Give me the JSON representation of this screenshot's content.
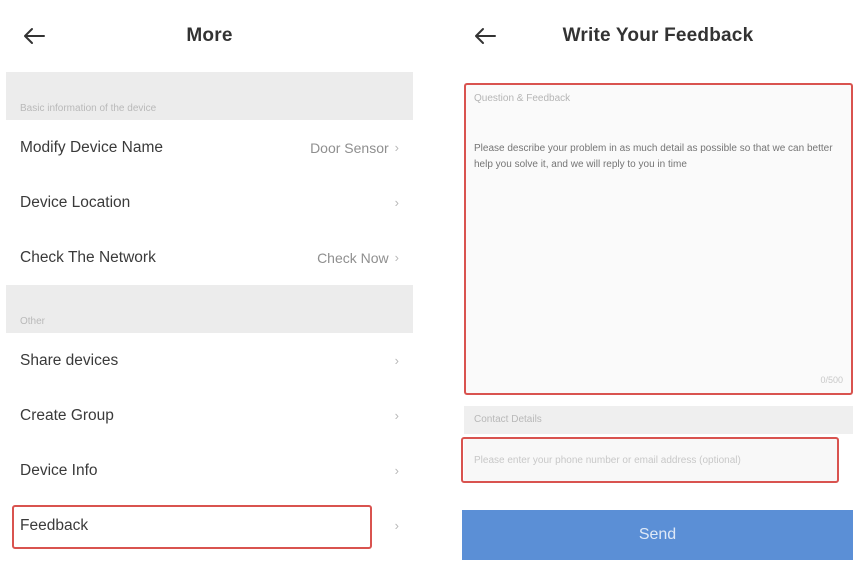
{
  "left": {
    "title": "More",
    "section1": {
      "header": "Basic information of the device"
    },
    "section1_rows": [
      {
        "label": "Modify Device Name",
        "value": "Door Sensor"
      },
      {
        "label": "Device Location",
        "value": ""
      },
      {
        "label": "Check The Network",
        "value": "Check Now"
      }
    ],
    "section2": {
      "header": "Other"
    },
    "section2_rows": [
      {
        "label": "Share devices"
      },
      {
        "label": "Create Group"
      },
      {
        "label": "Device Info"
      },
      {
        "label": "Feedback"
      }
    ]
  },
  "right": {
    "title": "Write Your Feedback",
    "feedback_label": "Question & Feedback",
    "feedback_placeholder": "Please describe your problem in as much detail as possible so that we can better help you solve it, and we will reply to you in time",
    "char_count": "0/500",
    "contact_label": "Contact Details",
    "contact_placeholder": "Please enter your phone number or email address (optional)",
    "send_label": "Send"
  },
  "colors": {
    "highlight": "#d9534f",
    "send_button": "#5b8fd6",
    "section_bg": "#ececec"
  },
  "icons": {
    "back": "arrow-left-icon",
    "chevron": "chevron-right-icon"
  }
}
